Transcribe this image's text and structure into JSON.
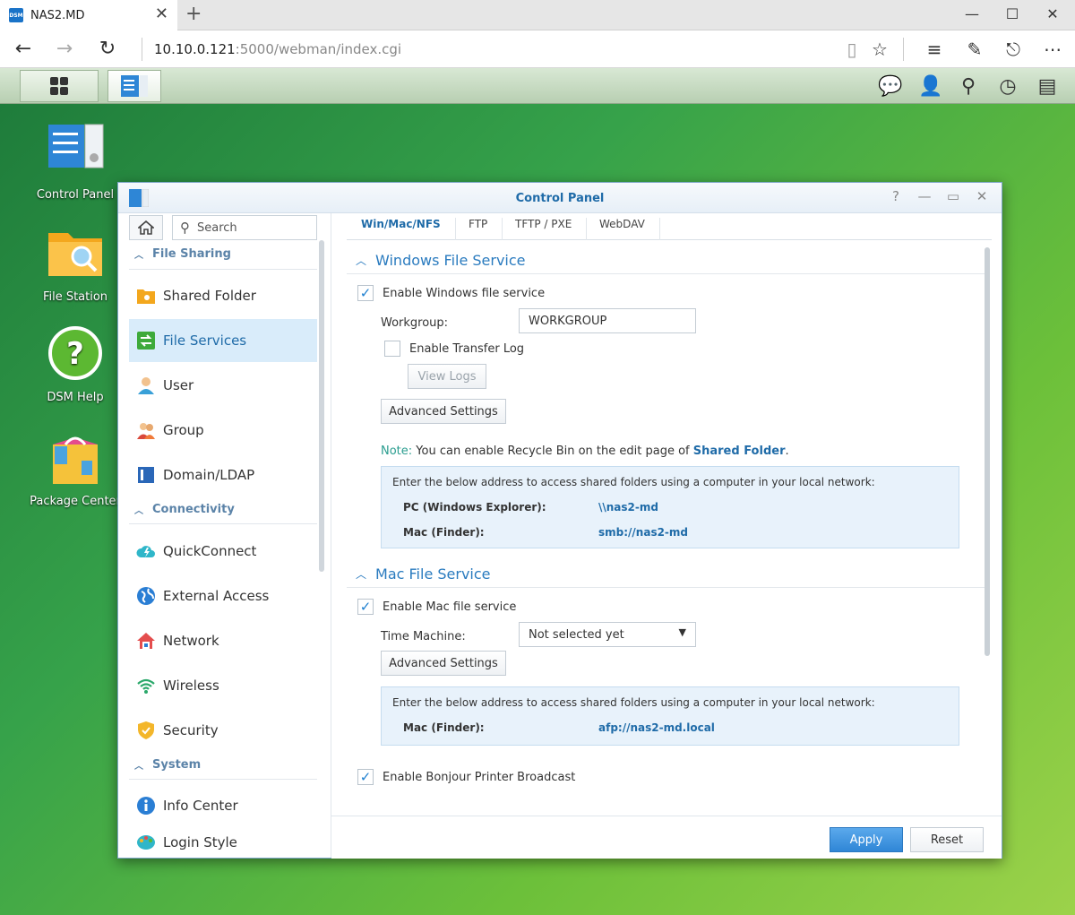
{
  "browser": {
    "tab_title": "NAS2.MD",
    "favicon_text": "DSM",
    "url_host": "10.10.0.121",
    "url_rest": ":5000/webman/index.cgi"
  },
  "desktop": {
    "icons": [
      {
        "label": "Control Panel"
      },
      {
        "label": "File Station"
      },
      {
        "label": "DSM Help"
      },
      {
        "label": "Package Center"
      }
    ]
  },
  "window": {
    "title": "Control Panel"
  },
  "sidebar": {
    "search_placeholder": "Search",
    "categories": {
      "file_sharing": "File Sharing",
      "connectivity": "Connectivity",
      "system": "System"
    },
    "items": {
      "shared_folder": "Shared Folder",
      "file_services": "File Services",
      "user": "User",
      "group": "Group",
      "domain_ldap": "Domain/LDAP",
      "quickconnect": "QuickConnect",
      "external_access": "External Access",
      "network": "Network",
      "wireless": "Wireless",
      "security": "Security",
      "info_center": "Info Center",
      "login_style": "Login Style"
    }
  },
  "tabs": [
    "Win/Mac/NFS",
    "FTP",
    "TFTP / PXE",
    "WebDAV"
  ],
  "windows_service": {
    "title": "Windows File Service",
    "enable_label": "Enable Windows file service",
    "enabled": true,
    "workgroup_label": "Workgroup:",
    "workgroup_value": "WORKGROUP",
    "transfer_log_label": "Enable Transfer Log",
    "transfer_log_enabled": false,
    "view_logs": "View Logs",
    "advanced": "Advanced Settings",
    "note_key": "Note:",
    "note_text": " You can enable Recycle Bin on the edit page of ",
    "note_link": "Shared Folder",
    "note_end": ".",
    "info_header": "Enter the below address to access shared folders using a computer in your local network:",
    "pc_label": "PC (Windows Explorer):",
    "pc_value": "\\\\nas2-md",
    "mac_label": "Mac (Finder):",
    "mac_value": "smb://nas2-md"
  },
  "mac_service": {
    "title": "Mac File Service",
    "enable_label": "Enable Mac file service",
    "enabled": true,
    "time_machine_label": "Time Machine:",
    "time_machine_value": "Not selected yet",
    "advanced": "Advanced Settings",
    "info_header": "Enter the below address to access shared folders using a computer in your local network:",
    "mac_label": "Mac (Finder):",
    "mac_value": "afp://nas2-md.local"
  },
  "bonjour": {
    "label": "Enable Bonjour Printer Broadcast",
    "enabled": true
  },
  "footer": {
    "apply": "Apply",
    "reset": "Reset"
  },
  "colors": {
    "accent": "#1f6ba8",
    "selected_bg": "#d9ecfa",
    "apply_bg": "#2f86d6"
  }
}
